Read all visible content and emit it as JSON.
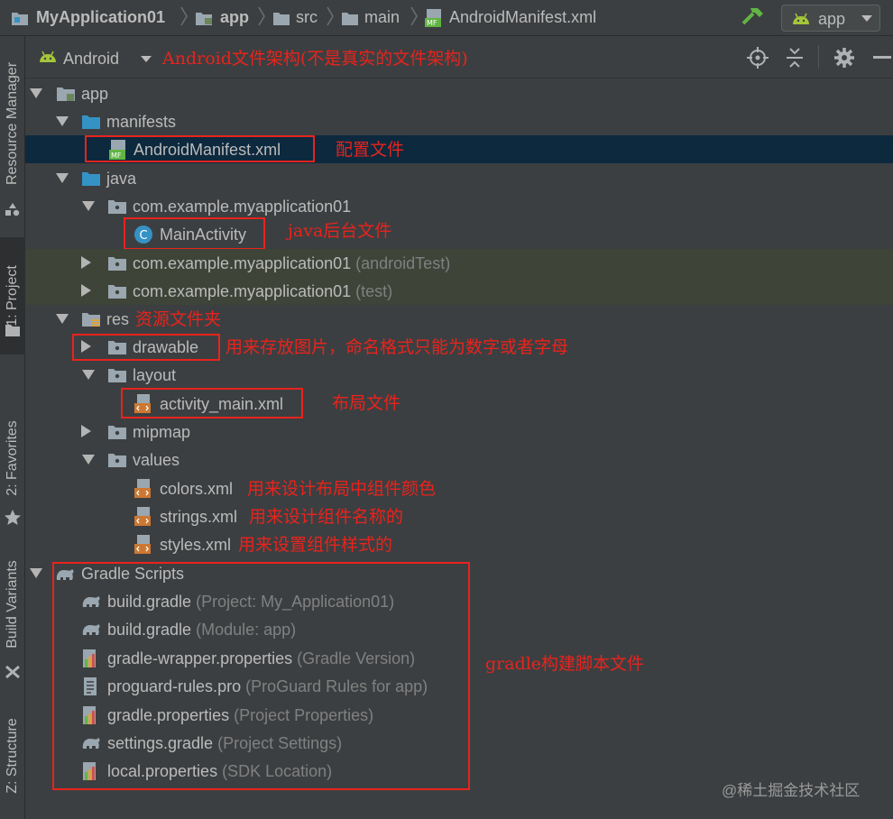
{
  "breadcrumb": {
    "project": "MyApplication01",
    "module": "app",
    "src": "src",
    "main": "main",
    "file": "AndroidManifest.xml"
  },
  "run_config": {
    "label": "app"
  },
  "side_tabs": {
    "resource_manager": "Resource Manager",
    "project": "1: Project",
    "favorites": "2: Favorites",
    "build_variants": "Build Variants",
    "structure": "Z: Structure"
  },
  "project_view": {
    "mode": "Android"
  },
  "tree": {
    "app": "app",
    "manifests": "manifests",
    "android_manifest": "AndroidManifest.xml",
    "java": "java",
    "pkg_main": "com.example.myapplication01",
    "main_activity": "MainActivity",
    "pkg_android_test": "com.example.myapplication01",
    "pkg_android_test_suffix": "(androidTest)",
    "pkg_test": "com.example.myapplication01",
    "pkg_test_suffix": "(test)",
    "res": "res",
    "drawable": "drawable",
    "layout": "layout",
    "activity_main": "activity_main.xml",
    "mipmap": "mipmap",
    "values": "values",
    "colors": "colors.xml",
    "strings": "strings.xml",
    "styles": "styles.xml",
    "gradle_scripts": "Gradle Scripts",
    "gradle_items": [
      {
        "name": "build.gradle",
        "hint": "(Project: My_Application01)",
        "icon": "gradle-elephant-icon"
      },
      {
        "name": "build.gradle",
        "hint": "(Module: app)",
        "icon": "gradle-elephant-icon"
      },
      {
        "name": "gradle-wrapper.properties",
        "hint": "(Gradle Version)",
        "icon": "properties-file-icon"
      },
      {
        "name": "proguard-rules.pro",
        "hint": "(ProGuard Rules for app)",
        "icon": "text-file-icon"
      },
      {
        "name": "gradle.properties",
        "hint": "(Project Properties)",
        "icon": "properties-file-icon"
      },
      {
        "name": "settings.gradle",
        "hint": "(Project Settings)",
        "icon": "gradle-elephant-icon"
      },
      {
        "name": "local.properties",
        "hint": "(SDK Location)",
        "icon": "properties-file-icon"
      }
    ]
  },
  "annotations": {
    "android_view": "Android文件架构(不是真实的文件架构)",
    "manifest": "配置文件",
    "main_activity": "java后台文件",
    "res": "资源文件夹",
    "drawable": "用来存放图片，命名格式只能为数字或者字母",
    "activity_main": "布局文件",
    "colors": "用来设计布局中组件颜色",
    "strings": "用来设计组件名称的",
    "styles": "用来设置组件样式的",
    "gradle": "gradle构建脚本文件"
  },
  "watermark": "@稀土掘金技术社区",
  "colors": {
    "background": "#3c3f41",
    "selection": "#0d293e",
    "annotation_red": "#e8231d",
    "folder_blue": "#3592c4",
    "android_green": "#a4c639",
    "hint_gray": "#808080"
  }
}
